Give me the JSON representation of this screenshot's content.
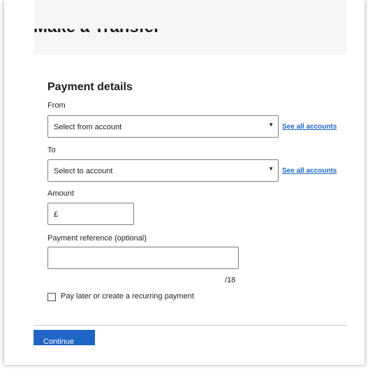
{
  "header": {
    "title": "Make a Transfer"
  },
  "form": {
    "section_title": "Payment details",
    "from": {
      "label": "From",
      "value": "Select from account",
      "link": "See all accounts"
    },
    "to": {
      "label": "To",
      "value": "Select to account",
      "link": "See all accounts"
    },
    "amount": {
      "label": "Amount",
      "currency": "£"
    },
    "reference": {
      "label": "Payment reference (optional)",
      "counter": "/18"
    },
    "recurring": {
      "label": "Pay later or create a recurring payment"
    }
  },
  "actions": {
    "continue_label": "Continue"
  },
  "colors": {
    "accent": "#1f66c7",
    "header_bg": "#f5f6f7"
  },
  "icons": {
    "dropdown": "caret-down-icon"
  }
}
